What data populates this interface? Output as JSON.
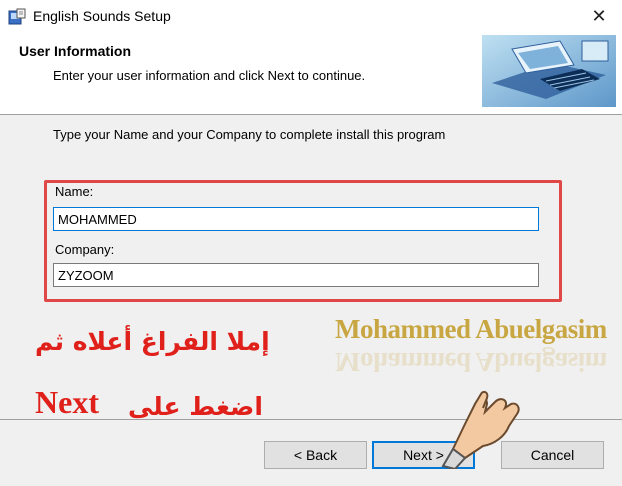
{
  "window": {
    "title": "English Sounds Setup",
    "close_glyph": "✕",
    "icon": "setup-icon"
  },
  "header": {
    "title": "User Information",
    "subtitle": "Enter your user information and click Next to continue.",
    "banner_icon": "computer-banner-image"
  },
  "body": {
    "instruction": "Type your Name and your Company  to complete install this program"
  },
  "form": {
    "name_label": "Name:",
    "name_value": "MOHAMMED",
    "company_label": "Company:",
    "company_value": "ZYZOOM"
  },
  "overlay": {
    "signature": "Mohammed Abuelgasim",
    "arabic_line1": "إملا الفراغ أعلاه ثم",
    "arabic_line2": "اضغط على",
    "next_word": "Next"
  },
  "buttons": {
    "back": "< Back",
    "next": "Next >",
    "cancel": "Cancel"
  },
  "colors": {
    "highlight": "#e04848",
    "annotation_red": "#e0201a",
    "signature_gold": "#c8a642",
    "focus_blue": "#0078d7"
  }
}
